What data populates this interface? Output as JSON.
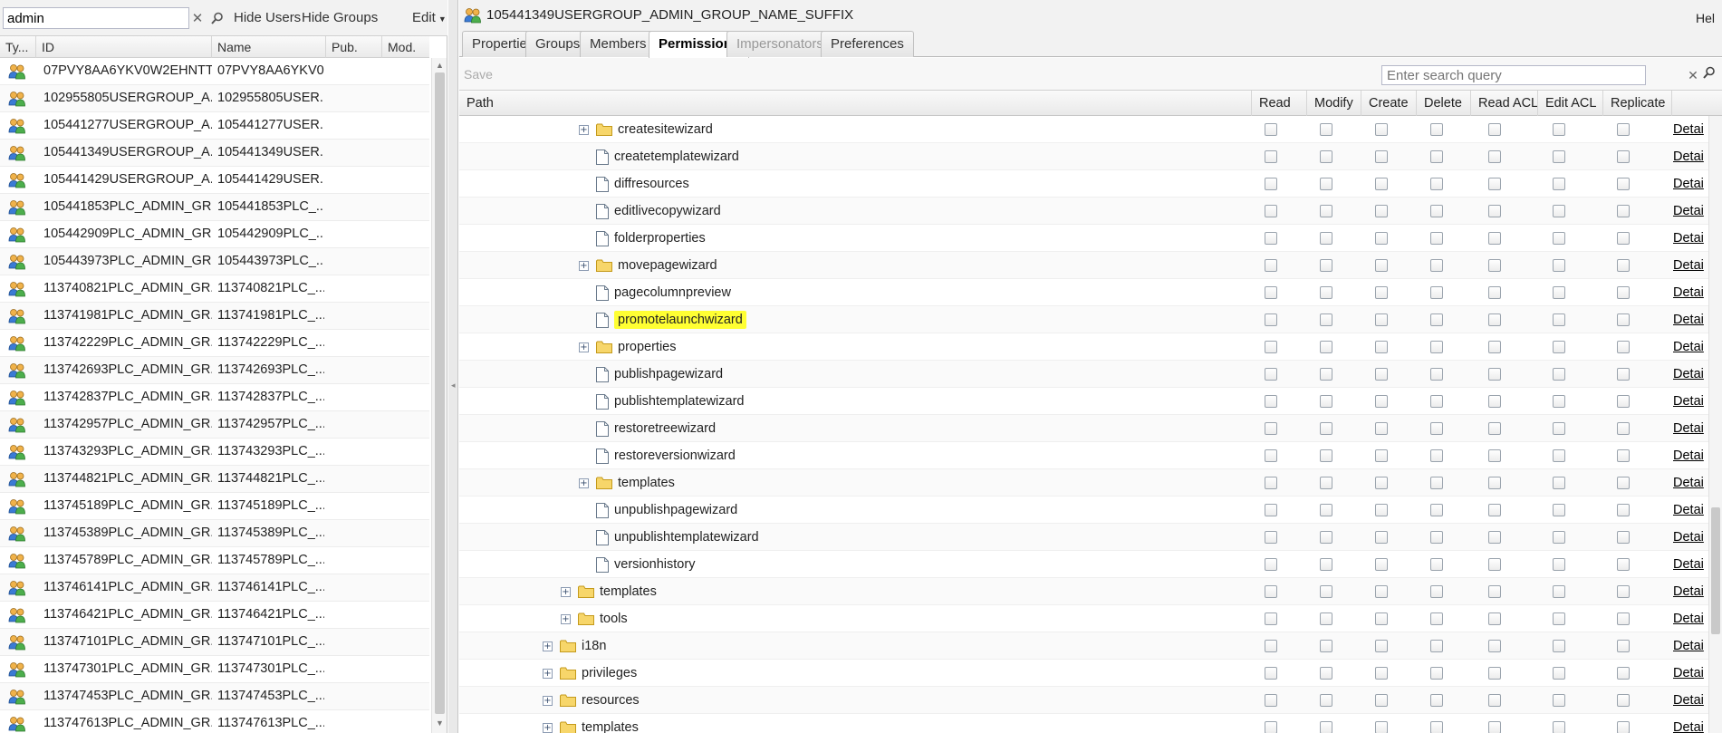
{
  "left_panel": {
    "search_value": "admin",
    "search_placeholder": "",
    "hide_users_label": "Hide Users",
    "hide_groups_label": "Hide Groups",
    "edit_label": "Edit",
    "columns": [
      "Ty...",
      "ID",
      "Name",
      "Pub.",
      "Mod."
    ],
    "rows": [
      {
        "id": "07PVY8AA6YKV0W2EHNTT...",
        "name": "07PVY8AA6YKV0..."
      },
      {
        "id": "102955805USERGROUP_A...",
        "name": "102955805USER..."
      },
      {
        "id": "105441277USERGROUP_A...",
        "name": "105441277USER..."
      },
      {
        "id": "105441349USERGROUP_A...",
        "name": "105441349USER..."
      },
      {
        "id": "105441429USERGROUP_A...",
        "name": "105441429USER..."
      },
      {
        "id": "105441853PLC_ADMIN_GR...",
        "name": "105441853PLC_..."
      },
      {
        "id": "105442909PLC_ADMIN_GR...",
        "name": "105442909PLC_..."
      },
      {
        "id": "105443973PLC_ADMIN_GR...",
        "name": "105443973PLC_..."
      },
      {
        "id": "113740821PLC_ADMIN_GR...",
        "name": "113740821PLC_..."
      },
      {
        "id": "113741981PLC_ADMIN_GR...",
        "name": "113741981PLC_..."
      },
      {
        "id": "113742229PLC_ADMIN_GR...",
        "name": "113742229PLC_..."
      },
      {
        "id": "113742693PLC_ADMIN_GR...",
        "name": "113742693PLC_..."
      },
      {
        "id": "113742837PLC_ADMIN_GR...",
        "name": "113742837PLC_..."
      },
      {
        "id": "113742957PLC_ADMIN_GR...",
        "name": "113742957PLC_..."
      },
      {
        "id": "113743293PLC_ADMIN_GR...",
        "name": "113743293PLC_..."
      },
      {
        "id": "113744821PLC_ADMIN_GR...",
        "name": "113744821PLC_..."
      },
      {
        "id": "113745189PLC_ADMIN_GR...",
        "name": "113745189PLC_..."
      },
      {
        "id": "113745389PLC_ADMIN_GR...",
        "name": "113745389PLC_..."
      },
      {
        "id": "113745789PLC_ADMIN_GR...",
        "name": "113745789PLC_..."
      },
      {
        "id": "113746141PLC_ADMIN_GR...",
        "name": "113746141PLC_..."
      },
      {
        "id": "113746421PLC_ADMIN_GR...",
        "name": "113746421PLC_..."
      },
      {
        "id": "113747101PLC_ADMIN_GR...",
        "name": "113747101PLC_..."
      },
      {
        "id": "113747301PLC_ADMIN_GR...",
        "name": "113747301PLC_..."
      },
      {
        "id": "113747453PLC_ADMIN_GR...",
        "name": "113747453PLC_..."
      },
      {
        "id": "113747613PLC_ADMIN_GR...",
        "name": "113747613PLC_..."
      }
    ]
  },
  "right_panel": {
    "title": "105441349USERGROUP_ADMIN_GROUP_NAME_SUFFIX",
    "help_label": "Hel",
    "tabs": [
      {
        "label": "Properties",
        "state": "normal"
      },
      {
        "label": "Groups",
        "state": "normal"
      },
      {
        "label": "Members",
        "state": "normal"
      },
      {
        "label": "Permissions",
        "state": "active"
      },
      {
        "label": "Impersonators",
        "state": "disabled"
      },
      {
        "label": "Preferences",
        "state": "normal"
      }
    ],
    "save_label": "Save",
    "search_placeholder": "Enter search query",
    "columns": [
      "Path",
      "Read",
      "Modify",
      "Create",
      "Delete",
      "Read ACL",
      "Edit ACL",
      "Replicate"
    ],
    "detail_label": "Detai",
    "rows": [
      {
        "label": "createsitewizard",
        "kind": "folder",
        "level": 2,
        "expandable": true
      },
      {
        "label": "createtemplatewizard",
        "kind": "page",
        "level": 2,
        "expandable": false
      },
      {
        "label": "diffresources",
        "kind": "page",
        "level": 2,
        "expandable": false
      },
      {
        "label": "editlivecopywizard",
        "kind": "page",
        "level": 2,
        "expandable": false
      },
      {
        "label": "folderproperties",
        "kind": "page",
        "level": 2,
        "expandable": false
      },
      {
        "label": "movepagewizard",
        "kind": "folder",
        "level": 2,
        "expandable": true
      },
      {
        "label": "pagecolumnpreview",
        "kind": "page",
        "level": 2,
        "expandable": false
      },
      {
        "label": "promotelaunchwizard",
        "kind": "page",
        "level": 2,
        "expandable": false,
        "highlighted": true
      },
      {
        "label": "properties",
        "kind": "folder",
        "level": 2,
        "expandable": true
      },
      {
        "label": "publishpagewizard",
        "kind": "page",
        "level": 2,
        "expandable": false
      },
      {
        "label": "publishtemplatewizard",
        "kind": "page",
        "level": 2,
        "expandable": false
      },
      {
        "label": "restoretreewizard",
        "kind": "page",
        "level": 2,
        "expandable": false
      },
      {
        "label": "restoreversionwizard",
        "kind": "page",
        "level": 2,
        "expandable": false
      },
      {
        "label": "templates",
        "kind": "folder",
        "level": 2,
        "expandable": true
      },
      {
        "label": "unpublishpagewizard",
        "kind": "page",
        "level": 2,
        "expandable": false
      },
      {
        "label": "unpublishtemplatewizard",
        "kind": "page",
        "level": 2,
        "expandable": false
      },
      {
        "label": "versionhistory",
        "kind": "page",
        "level": 2,
        "expandable": false
      },
      {
        "label": "templates",
        "kind": "folder",
        "level": 1,
        "expandable": true
      },
      {
        "label": "tools",
        "kind": "folder",
        "level": 1,
        "expandable": true
      },
      {
        "label": "i18n",
        "kind": "folder",
        "level": 0,
        "expandable": true
      },
      {
        "label": "privileges",
        "kind": "folder",
        "level": 0,
        "expandable": true
      },
      {
        "label": "resources",
        "kind": "folder",
        "level": 0,
        "expandable": true
      },
      {
        "label": "templates",
        "kind": "folder",
        "level": 0,
        "expandable": true
      }
    ]
  },
  "colors": {
    "highlight": "#ffff33",
    "folder_fill": "#f7d66a",
    "folder_stroke": "#c49a1c"
  }
}
